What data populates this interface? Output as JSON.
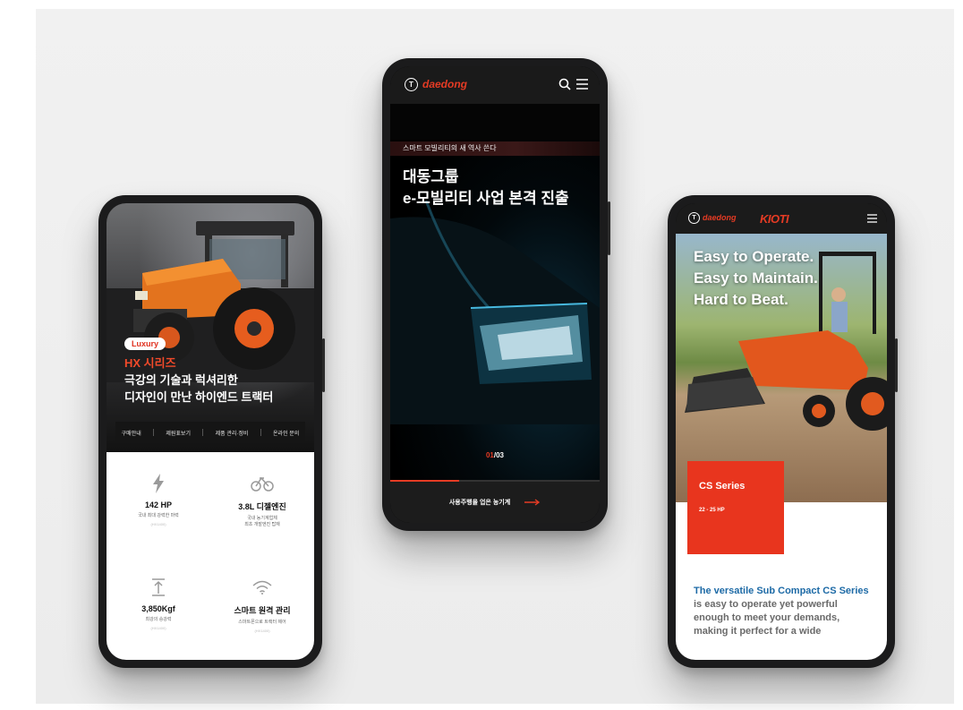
{
  "phone1": {
    "badge": "Luxury",
    "series_title": "HX 시리즈",
    "headline_line1": "극강의 기술과 럭셔리한",
    "headline_line2": "디자인이 만난 하이엔드 트랙터",
    "nav": [
      "구매안내",
      "제원표보기",
      "제품 관리·정비",
      "온라인 문의"
    ],
    "specs": [
      {
        "icon": "lightning-icon",
        "value": "142 HP",
        "desc": "국내 최대 강력한 마력",
        "note": "(HX1400)"
      },
      {
        "icon": "engine-icon",
        "value": "3.8L 디젤엔진",
        "desc": "국내 농기계업체\n최초 개발엔진 탑재",
        "note": ""
      },
      {
        "icon": "lift-icon",
        "value": "3,850Kgf",
        "desc": "최강의 승강력",
        "note": "(HX1400)"
      },
      {
        "icon": "wifi-icon",
        "value": "스마트 원격 관리",
        "desc": "스마트폰으로 트랙터 제어",
        "note": "(HX1400)"
      }
    ]
  },
  "phone2": {
    "logo": "daedong",
    "tagline": "스마트 모빌리티의 새 역사 쓴다",
    "headline_line1": "대동그룹",
    "headline_line2": "e-모빌리티 사업 본격 진출",
    "pager": {
      "current": "01",
      "separator": "/",
      "total": "03"
    },
    "progress": 0.33,
    "cta": "사용주행을 업은 농기계"
  },
  "phone3": {
    "logo": "daedong",
    "brand": "KIOTI",
    "headline": [
      "Easy to Operate.",
      "Easy to Maintain.",
      "Hard to Beat."
    ],
    "series": "CS Series",
    "hp": "22 - 25 HP",
    "desc_highlight": "The versatile Sub Compact CS Series",
    "desc_rest": " is easy to operate yet powerful enough to meet your demands,",
    "desc_line2": "making it perfect for a wide"
  },
  "colors": {
    "accent": "#e53b24",
    "link": "#1d6aa6"
  }
}
